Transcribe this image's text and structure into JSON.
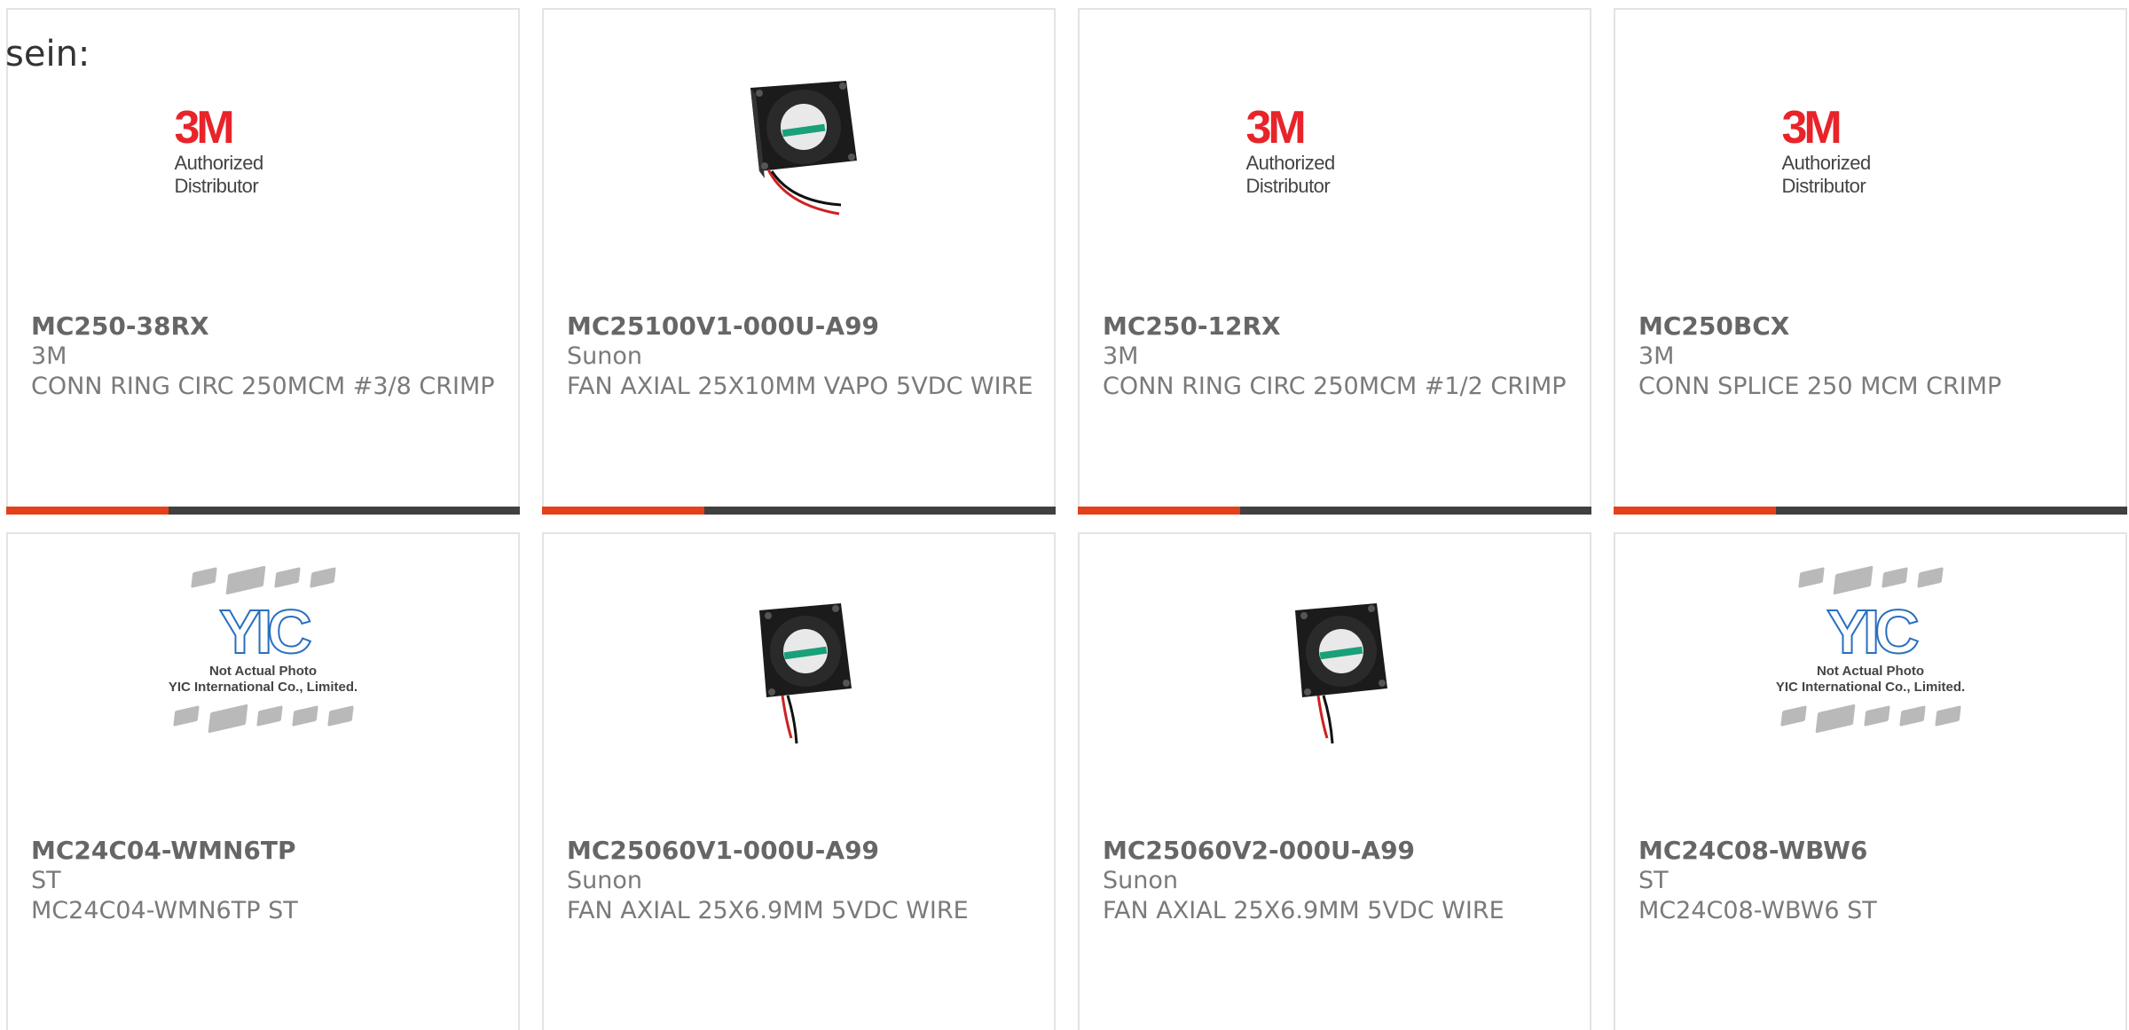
{
  "intro_text": "sein:",
  "logos": {
    "brand_3m": "3M",
    "authorized": "Authorized Distributor",
    "yic_mark": "YIC",
    "yic_note_1": "Not Actual Photo",
    "yic_note_2": "YIC International Co., Limited."
  },
  "accent_color": "#e4411b",
  "bar_color": "#404040",
  "products": [
    {
      "part": "MC250-38RX",
      "maker": "3M",
      "desc": "CONN RING CIRC 250MCM #3/8 CRIMP",
      "image": "3m-logo"
    },
    {
      "part": "MC25100V1-000U-A99",
      "maker": "Sunon",
      "desc": "FAN AXIAL 25X10MM VAPO 5VDC WIRE",
      "image": "fan-photo"
    },
    {
      "part": "MC250-12RX",
      "maker": "3M",
      "desc": "CONN RING CIRC 250MCM #1/2 CRIMP",
      "image": "3m-logo"
    },
    {
      "part": "MC250BCX",
      "maker": "3M",
      "desc": "CONN SPLICE 250 MCM CRIMP",
      "image": "3m-logo"
    },
    {
      "part": "MC24C04-WMN6TP",
      "maker": "ST",
      "desc": "MC24C04-WMN6TP ST",
      "image": "yic-placeholder"
    },
    {
      "part": "MC25060V1-000U-A99",
      "maker": "Sunon",
      "desc": "FAN AXIAL 25X6.9MM 5VDC WIRE",
      "image": "fan-photo"
    },
    {
      "part": "MC25060V2-000U-A99",
      "maker": "Sunon",
      "desc": "FAN AXIAL 25X6.9MM 5VDC WIRE",
      "image": "fan-photo"
    },
    {
      "part": "MC24C08-WBW6",
      "maker": "ST",
      "desc": "MC24C08-WBW6 ST",
      "image": "yic-placeholder"
    }
  ]
}
